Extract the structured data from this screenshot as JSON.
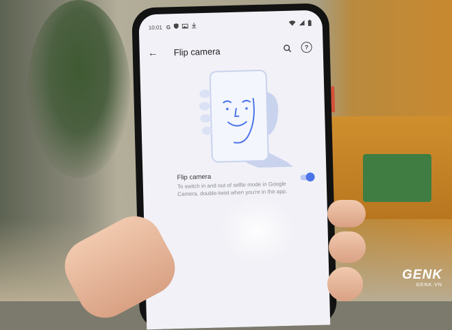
{
  "status_bar": {
    "time": "10:01",
    "left_icons": [
      "google-g-icon",
      "shield-icon",
      "image-icon",
      "download-icon"
    ],
    "right_icons": [
      "wifi-icon",
      "signal-icon",
      "battery-icon"
    ]
  },
  "app_bar": {
    "title": "Flip camera",
    "back_icon": "arrow-back-icon",
    "search_icon": "search-icon",
    "help_icon": "help-icon",
    "help_glyph": "?"
  },
  "setting": {
    "title": "Flip camera",
    "description": "To switch in and out of selfie mode in Google Camera, double-twist when you're in the app.",
    "enabled": true
  },
  "colors": {
    "accent": "#4b74e8",
    "screen_bg": "#f1f1f7",
    "illustration": "#c9d3ee"
  },
  "watermark": {
    "logo": "GENK",
    "domain": "GENK.VN"
  }
}
